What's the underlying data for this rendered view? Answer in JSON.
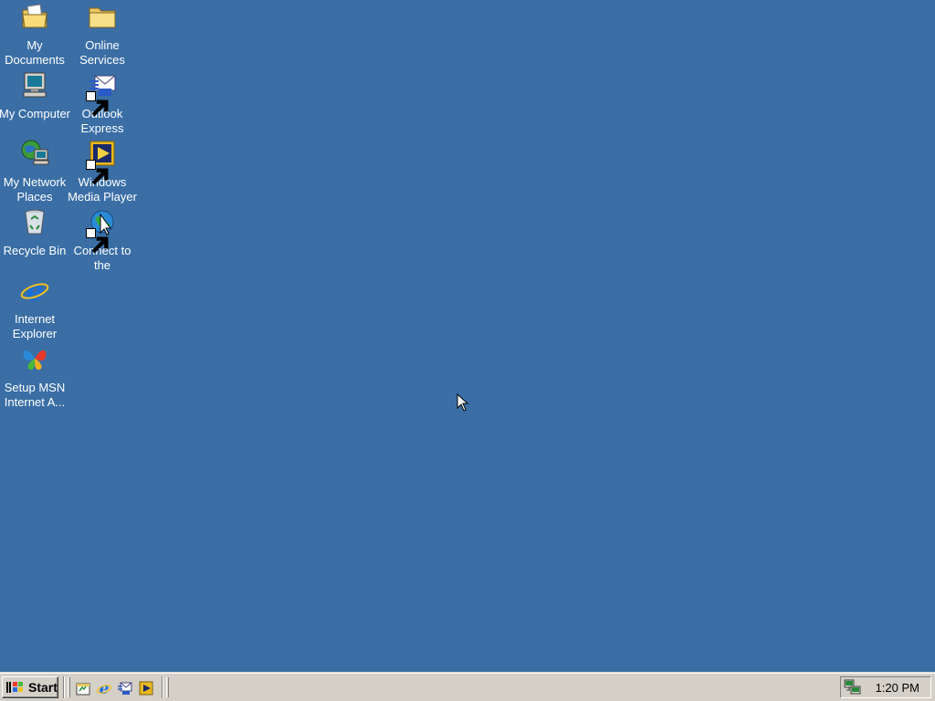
{
  "desktop": {
    "background_color": "#3a6ea5",
    "icons_col1": [
      {
        "label": "My Documents",
        "icon": "my-documents-icon"
      },
      {
        "label": "My Computer",
        "icon": "my-computer-icon"
      },
      {
        "label": "My Network\nPlaces",
        "icon": "my-network-places-icon"
      },
      {
        "label": "Recycle Bin",
        "icon": "recycle-bin-icon"
      },
      {
        "label": "Internet\nExplorer",
        "icon": "internet-explorer-icon"
      },
      {
        "label": "Setup MSN\nInternet A...",
        "icon": "msn-butterfly-icon"
      }
    ],
    "icons_col2": [
      {
        "label": "Online\nServices",
        "icon": "folder-icon"
      },
      {
        "label": "Outlook\nExpress",
        "icon": "outlook-express-icon"
      },
      {
        "label": "Windows\nMedia Player",
        "icon": "media-player-icon"
      },
      {
        "label": "Connect to the\nInternet",
        "icon": "connect-internet-icon"
      }
    ]
  },
  "taskbar": {
    "start_label": "Start",
    "quick_launch": [
      {
        "name": "show-desktop",
        "icon": "show-desktop-icon"
      },
      {
        "name": "internet-explorer",
        "icon": "ie-icon"
      },
      {
        "name": "outlook-express",
        "icon": "outlook-icon"
      },
      {
        "name": "media-player",
        "icon": "media-player-icon"
      }
    ],
    "clock": "1:20 PM"
  }
}
